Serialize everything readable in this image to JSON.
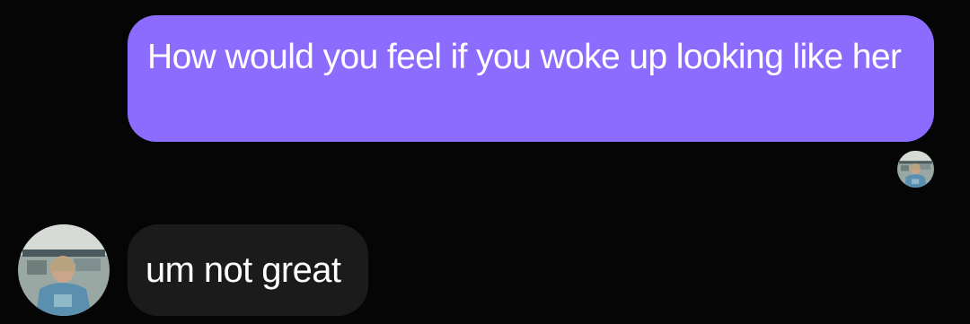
{
  "conversation": {
    "messages": [
      {
        "direction": "outgoing",
        "text": "How would you feel if you woke up looking like her"
      },
      {
        "direction": "incoming",
        "text": "um not great"
      }
    ]
  },
  "colors": {
    "background": "#050505",
    "outgoing_bubble": "#8c6cff",
    "incoming_bubble": "#1b1b1b",
    "text": "#ffffff"
  },
  "icons": {
    "read_receipt": "avatar-photo",
    "sender_avatar": "avatar-photo"
  }
}
